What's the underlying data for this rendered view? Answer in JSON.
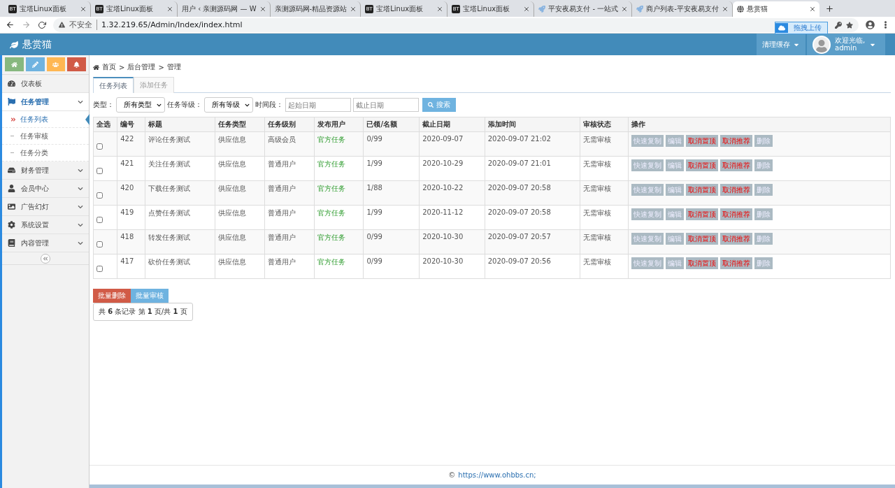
{
  "browser": {
    "tabs": [
      {
        "title": "宝塔Linux面板",
        "kind": "badge",
        "badge": "BT",
        "selected": false
      },
      {
        "title": "宝塔Linux面板",
        "kind": "badge",
        "badge": "BT",
        "selected": false
      },
      {
        "title": "用户 ‹ 亲测源码网 — W",
        "kind": "wordpress",
        "selected": false
      },
      {
        "title": "亲测源码网-精品资源站",
        "kind": "wordpress",
        "selected": false
      },
      {
        "title": "宝塔Linux面板",
        "kind": "badge",
        "badge": "BT",
        "selected": false
      },
      {
        "title": "宝塔Linux面板",
        "kind": "badge",
        "badge": "BT",
        "selected": false
      },
      {
        "title": "平安夜易支付 - 一站式",
        "kind": "rocket",
        "selected": false
      },
      {
        "title": "商户列表-平安夜易支付",
        "kind": "rocket",
        "selected": false
      },
      {
        "title": "悬赏猫",
        "kind": "globe",
        "selected": true
      }
    ],
    "security": "不安全",
    "url": "1.32.219.65/Admin/Index/index.html",
    "upload_badge": "拖拽上传"
  },
  "header": {
    "brand": "悬赏猫",
    "clear_cache": "清理缓存",
    "welcome": "欢迎光临,",
    "user": "admin"
  },
  "sidebar": {
    "items": [
      {
        "label": "仪表板",
        "expanded": false
      },
      {
        "label": "任务管理",
        "expanded": true,
        "children": [
          {
            "label": "任务列表",
            "selected": true
          },
          {
            "label": "任务审核",
            "selected": false
          },
          {
            "label": "任务分类",
            "selected": false
          }
        ]
      },
      {
        "label": "财务管理",
        "expanded": false
      },
      {
        "label": "会员中心",
        "expanded": false
      },
      {
        "label": "广告幻灯",
        "expanded": false
      },
      {
        "label": "系统设置",
        "expanded": false
      },
      {
        "label": "内容管理",
        "expanded": false
      }
    ]
  },
  "breadcrumb": [
    "首页",
    ">",
    "后台管理",
    ">",
    "管理"
  ],
  "tabs": [
    {
      "label": "任务列表",
      "selected": true
    },
    {
      "label": "添加任务",
      "selected": false
    }
  ],
  "filters": {
    "type_label": "类型：",
    "type_value": "所有类型",
    "level_label": "任务等级：",
    "level_value": "所有等级",
    "period_label": "时间段：",
    "start_placeholder": "起始日期",
    "end_placeholder": "截止日期",
    "search": "搜索"
  },
  "table": {
    "columns": [
      "全选",
      "编号",
      "标题",
      "任务类型",
      "任务级别",
      "发布用户",
      "已领/名额",
      "截止日期",
      "添加时间",
      "审核状态",
      "操作"
    ],
    "rows": [
      {
        "checked": false,
        "id": "422",
        "title": "评论任务测试",
        "type": "供应信息",
        "level": "高级会员",
        "publisher": "官方任务",
        "quota": "0/99",
        "deadline": "2020-09-07",
        "added": "2020-09-07 21:02",
        "review": "无需审核",
        "actions": [
          {
            "label": "快速复制",
            "kind": "plain"
          },
          {
            "label": "编辑",
            "kind": "plain"
          },
          {
            "label": "取消置顶",
            "kind": "warning"
          },
          {
            "label": "取消推荐",
            "kind": "warning"
          },
          {
            "label": "删除",
            "kind": "plain"
          }
        ]
      },
      {
        "checked": false,
        "id": "421",
        "title": "关注任务测试",
        "type": "供应信息",
        "level": "普通用户",
        "publisher": "官方任务",
        "quota": "1/99",
        "deadline": "2020-10-29",
        "added": "2020-09-07 21:01",
        "review": "无需审核",
        "actions": [
          {
            "label": "快速复制",
            "kind": "plain"
          },
          {
            "label": "编辑",
            "kind": "plain"
          },
          {
            "label": "取消置顶",
            "kind": "warning"
          },
          {
            "label": "取消推荐",
            "kind": "warning"
          },
          {
            "label": "删除",
            "kind": "plain"
          }
        ]
      },
      {
        "checked": false,
        "id": "420",
        "title": "下载任务测试",
        "type": "供应信息",
        "level": "普通用户",
        "publisher": "官方任务",
        "quota": "1/88",
        "deadline": "2020-10-22",
        "added": "2020-09-07 20:58",
        "review": "无需审核",
        "actions": [
          {
            "label": "快速复制",
            "kind": "plain"
          },
          {
            "label": "编辑",
            "kind": "plain"
          },
          {
            "label": "取消置顶",
            "kind": "warning"
          },
          {
            "label": "取消推荐",
            "kind": "warning"
          },
          {
            "label": "删除",
            "kind": "plain"
          }
        ]
      },
      {
        "checked": false,
        "id": "419",
        "title": "点赞任务测试",
        "type": "供应信息",
        "level": "普通用户",
        "publisher": "官方任务",
        "quota": "1/99",
        "deadline": "2020-11-12",
        "added": "2020-09-07 20:58",
        "review": "无需审核",
        "actions": [
          {
            "label": "快速复制",
            "kind": "plain"
          },
          {
            "label": "编辑",
            "kind": "plain"
          },
          {
            "label": "取消置顶",
            "kind": "warning"
          },
          {
            "label": "取消推荐",
            "kind": "warning"
          },
          {
            "label": "删除",
            "kind": "plain"
          }
        ]
      },
      {
        "checked": false,
        "id": "418",
        "title": "转发任务测试",
        "type": "供应信息",
        "level": "普通用户",
        "publisher": "官方任务",
        "quota": "0/99",
        "deadline": "2020-10-30",
        "added": "2020-09-07 20:57",
        "review": "无需审核",
        "actions": [
          {
            "label": "快速复制",
            "kind": "plain"
          },
          {
            "label": "编辑",
            "kind": "plain"
          },
          {
            "label": "取消置顶",
            "kind": "warning"
          },
          {
            "label": "取消推荐",
            "kind": "warning"
          },
          {
            "label": "删除",
            "kind": "plain"
          }
        ]
      },
      {
        "checked": false,
        "id": "417",
        "title": "砍价任务测试",
        "type": "供应信息",
        "level": "普通用户",
        "publisher": "官方任务",
        "quota": "0/99",
        "deadline": "2020-10-30",
        "added": "2020-09-07 20:56",
        "review": "无需审核",
        "actions": [
          {
            "label": "快速复制",
            "kind": "plain"
          },
          {
            "label": "编辑",
            "kind": "plain"
          },
          {
            "label": "取消置顶",
            "kind": "warning"
          },
          {
            "label": "取消推荐",
            "kind": "warning"
          },
          {
            "label": "删除",
            "kind": "plain"
          }
        ]
      }
    ]
  },
  "bulk_actions": [
    {
      "label": "批量删除",
      "kind": "danger"
    },
    {
      "label": "批量审核",
      "kind": "info"
    }
  ],
  "pagination": "共 **6** 条记录 第 **1** 页/共 **1** 页",
  "footer": {
    "symbol": "©",
    "link": "https://www.ohbbs.cn;"
  }
}
